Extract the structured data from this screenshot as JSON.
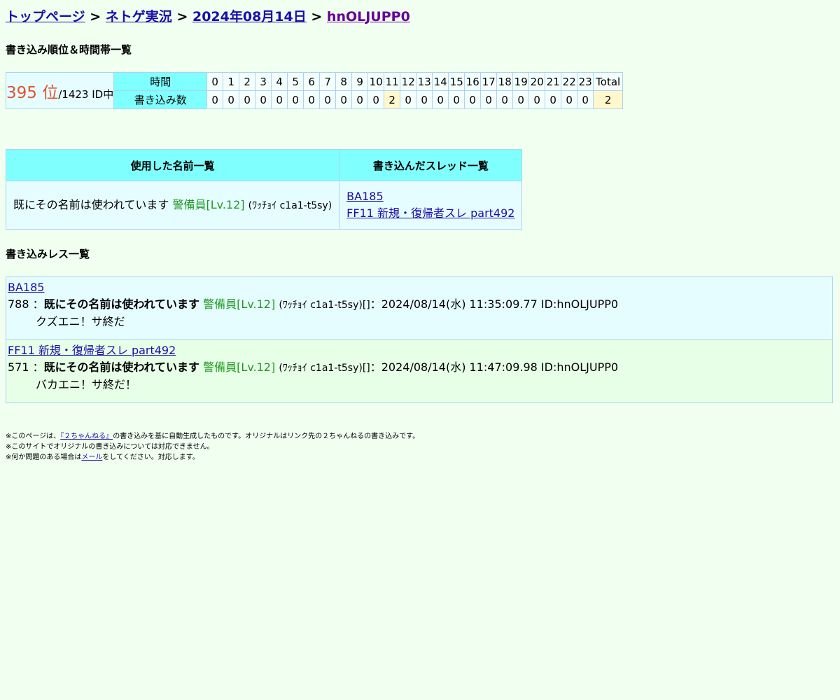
{
  "breadcrumb": {
    "items": [
      "トップページ",
      "ネトゲ実況",
      "2024年08月14日",
      "hnOLJUPP0"
    ],
    "separator": ">"
  },
  "rank_section": {
    "heading": "書き込み順位＆時間帯一覧",
    "rank_value": "395 位",
    "rank_total": "/1423 ID中",
    "time_label": "時間",
    "count_label": "書き込み数",
    "hours": [
      "0",
      "1",
      "2",
      "3",
      "4",
      "5",
      "6",
      "7",
      "8",
      "9",
      "10",
      "11",
      "12",
      "13",
      "14",
      "15",
      "16",
      "17",
      "18",
      "19",
      "20",
      "21",
      "22",
      "23",
      "Total"
    ],
    "counts": [
      "0",
      "0",
      "0",
      "0",
      "0",
      "0",
      "0",
      "0",
      "0",
      "0",
      "0",
      "2",
      "0",
      "0",
      "0",
      "0",
      "0",
      "0",
      "0",
      "0",
      "0",
      "0",
      "0",
      "0",
      "2"
    ]
  },
  "info_table": {
    "names_header": "使用した名前一覧",
    "threads_header": "書き込んだスレッド一覧",
    "name_text": "既にその名前は使われています",
    "name_level": "警備員[Lv.12]",
    "name_trip": "(ﾜｯﾁｮｲ c1a1-t5sy)",
    "threads": [
      "BA185",
      "FF11 新規・復帰者スレ part492"
    ]
  },
  "posts_section": {
    "heading": "書き込みレス一覧",
    "posts": [
      {
        "thread": "BA185",
        "number": "788",
        "colon": "：",
        "name": "既にその名前は使われています",
        "level": "警備員[Lv.12]",
        "trip": "(ﾜｯﾁｮｲ c1a1-t5sy)[]",
        "meta": "：2024/08/14(水) 11:35:09.77 ID:hnOLJUPP0",
        "body": "クズエニ！サ終だ"
      },
      {
        "thread": "FF11 新規・復帰者スレ part492",
        "number": "571",
        "colon": "：",
        "name": "既にその名前は使われています",
        "level": "警備員[Lv.12]",
        "trip": "(ﾜｯﾁｮｲ c1a1-t5sy)[]",
        "meta": "：2024/08/14(水) 11:47:09.98 ID:hnOLJUPP0",
        "body": "バカエニ！サ終だ！"
      }
    ]
  },
  "footer": {
    "line1_prefix": "※このページは、",
    "line1_link": "『２ちゃんねる』",
    "line1_suffix": "の書き込みを基に自動生成したものです。オリジナルはリンク先の２ちゃんねるの書き込みです。",
    "line2": "※このサイトでオリジナルの書き込みについては対応できません。",
    "line3_prefix": "※何か問題のある場合は",
    "line3_link": "メール",
    "line3_suffix": "をしてください。対応します。"
  }
}
